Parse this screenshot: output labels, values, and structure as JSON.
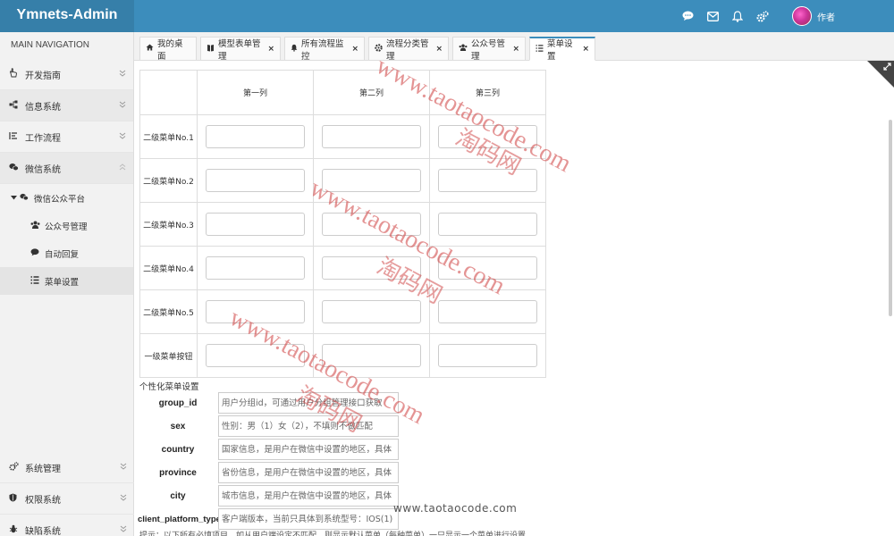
{
  "app": {
    "title": "Ymnets-Admin"
  },
  "header": {
    "icons": [
      "comment-icon",
      "mail-icon",
      "bell-icon",
      "gears-icon"
    ],
    "user_name": "作者"
  },
  "sidebar": {
    "header": "MAIN NAVIGATION",
    "items": [
      {
        "label": "开发指南",
        "icon": "hand-icon"
      },
      {
        "label": "信息系统",
        "icon": "sitemap-icon"
      },
      {
        "label": "工作流程",
        "icon": "list-icon"
      },
      {
        "label": "微信系统",
        "icon": "wechat-icon"
      }
    ],
    "wechat_group": {
      "label": "微信公众平台",
      "children": [
        {
          "label": "公众号管理",
          "icon": "users-icon"
        },
        {
          "label": "自动回复",
          "icon": "comment-icon"
        },
        {
          "label": "菜单设置",
          "icon": "list-icon"
        }
      ]
    },
    "bottom_items": [
      {
        "label": "系统管理",
        "icon": "gears-icon"
      },
      {
        "label": "权限系统",
        "icon": "shield-icon"
      },
      {
        "label": "缺陷系统",
        "icon": "bug-icon"
      }
    ]
  },
  "tabs": [
    {
      "label": "我的桌面",
      "icon": "home-icon",
      "closable": false
    },
    {
      "label": "模型表单管理",
      "icon": "book-icon",
      "closable": true
    },
    {
      "label": "所有流程监控",
      "icon": "bell-icon",
      "closable": true
    },
    {
      "label": "流程分类管理",
      "icon": "gear-icon",
      "closable": true
    },
    {
      "label": "公众号管理",
      "icon": "users-icon",
      "closable": true
    },
    {
      "label": "菜单设置",
      "icon": "list-icon",
      "closable": true,
      "active": true
    }
  ],
  "menu_grid": {
    "columns": [
      "第一列",
      "第二列",
      "第三列"
    ],
    "rows": [
      "二级菜单No.1",
      "二级菜单No.2",
      "二级菜单No.3",
      "二级菜单No.4",
      "二级菜单No.5",
      "一级菜单按钮"
    ]
  },
  "personalized": {
    "title": "个性化菜单设置",
    "fields": [
      {
        "label": "group_id",
        "placeholder": "用户分组id，可通过用户分组管理接口获取"
      },
      {
        "label": "sex",
        "placeholder": "性别：男（1）女（2），不填则不做匹配"
      },
      {
        "label": "country",
        "placeholder": "国家信息，是用户在微信中设置的地区，具体"
      },
      {
        "label": "province",
        "placeholder": "省份信息，是用户在微信中设置的地区，具体"
      },
      {
        "label": "city",
        "placeholder": "城市信息，是用户在微信中设置的地区，具体"
      },
      {
        "label": "client_platform_type",
        "placeholder": "客户端版本，当前只具体到系统型号：IOS(1)"
      }
    ],
    "cut_line": "提示：以下所有必填项目，如从用户端设定不匹配，则显示默认菜单（每种菜单）一只显示一个菜单进行设置"
  },
  "watermarks": {
    "url": "www.taotaocode.com",
    "cn": "淘码网",
    "bottom": "www.taotaocode.com"
  },
  "colors": {
    "header": "#3c8dbc",
    "logo_bg": "#367fa9",
    "watermark": "#cd3c3c"
  }
}
